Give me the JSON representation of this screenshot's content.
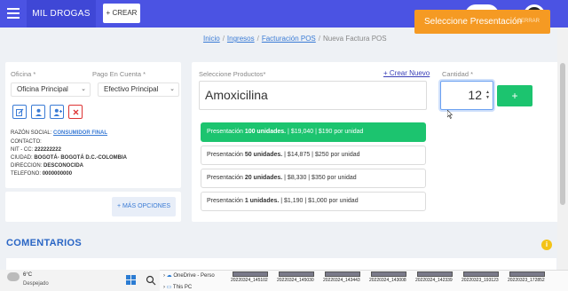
{
  "navbar": {
    "brand": "MIL DROGAS",
    "crear_label": "+ CREAR"
  },
  "toast": {
    "message": "Seleccione Presentación",
    "close_label": "CERRAR"
  },
  "breadcrumb": [
    "Inicio",
    "Ingresos",
    "Facturación POS",
    "Nueva Factura POS"
  ],
  "left": {
    "oficina_label": "Oficina *",
    "oficina_value": "Oficina Principal",
    "pago_label": "Pago En Cuenta *",
    "pago_value": "Efectivo Principal",
    "razon_label": "RAZÓN SOCIAL:",
    "razon_value": "CONSUMIDOR FINAL",
    "contacto_label": "CONTACTO:",
    "nit_label": "NIT - CC:",
    "nit_value": "222222222",
    "ciudad_label": "CIUDAD:",
    "ciudad_value": "BOGOTÁ- BOGOTÁ D.C.-COLOMBIA",
    "direccion_label": "DIRECCION:",
    "direccion_value": "DESCONOCIDA",
    "telefono_label": "TELEFONO:",
    "telefono_value": "0000000000",
    "mas_opciones": "+ MÁS OPCIONES"
  },
  "right": {
    "productos_label": "Seleccione Productos*",
    "crear_nuevo": "+ Crear Nuevo",
    "producto_value": "Amoxicilina",
    "cantidad_label": "Cantidad *",
    "cantidad_value": "12",
    "add_label": "+",
    "presentaciones": [
      {
        "prefix": "Presentación ",
        "units": "100 unidades.",
        "rest": " | $19,040 | $190 por unidad"
      },
      {
        "prefix": "Presentación ",
        "units": "50 unidades.",
        "rest": " | $14,875 | $250 por unidad"
      },
      {
        "prefix": "Presentación ",
        "units": "20 unidades.",
        "rest": " | $8,330 | $350 por unidad"
      },
      {
        "prefix": "Presentación ",
        "units": "1 unidades.",
        "rest": " | $1,190 | $1,000 por unidad"
      }
    ]
  },
  "comentarios": {
    "title": "COMENTARIOS",
    "info_icon": "i"
  },
  "taskbar": {
    "temp": "6°C",
    "weather": "Despejado"
  },
  "explorer": {
    "tree": [
      "OneDrive - Perso",
      "This PC"
    ],
    "thumbnails": [
      "20220324_145102",
      "20220324_145030",
      "20220324_143443",
      "20220324_143008",
      "20220324_142339",
      "20220323_193123",
      "20220323_172852"
    ]
  },
  "colors": {
    "navbar": "#4b53e3",
    "toast": "#f59a23",
    "primary": "#3a7bd5",
    "success": "#1cc46f"
  }
}
